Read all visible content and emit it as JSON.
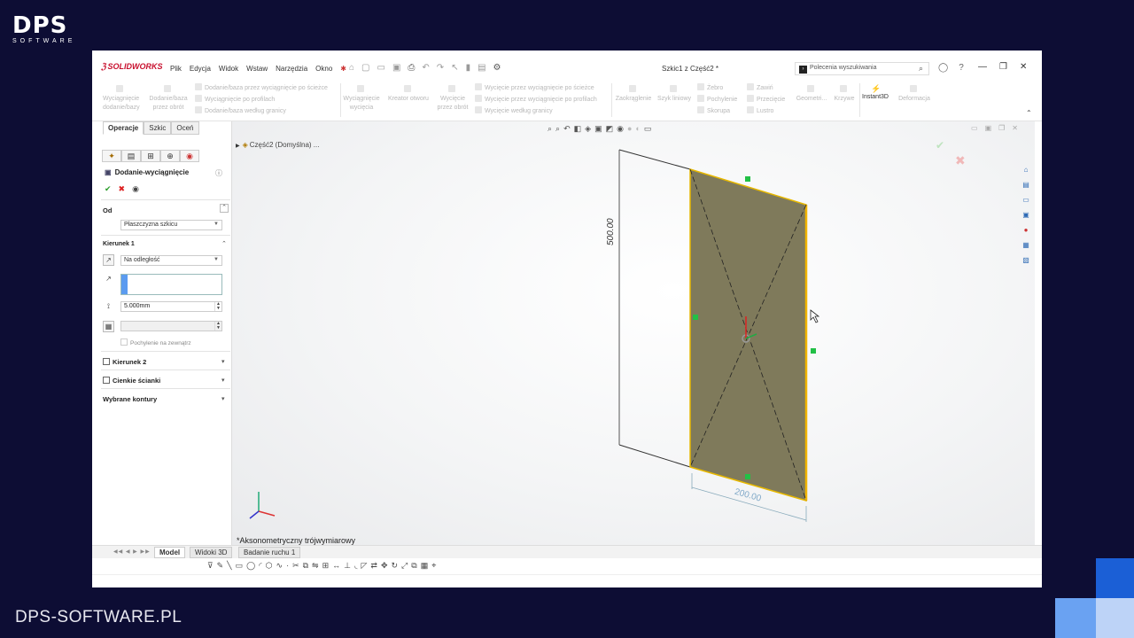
{
  "branding": {
    "logo_main": "DPS",
    "logo_sub": "SOFTWARE",
    "url": "DPS-SOFTWARE.PL"
  },
  "titlebar": {
    "app_logo": "SOLIDWORKS",
    "menus": [
      "Plik",
      "Edycja",
      "Widok",
      "Wstaw",
      "Narzędzia",
      "Okno"
    ],
    "doc_title": "Szkic1 z Część2 *",
    "search_placeholder": "Polecenia wyszukiwania",
    "win_minimize": "—",
    "win_restore": "❐",
    "win_close": "✕"
  },
  "command_manager": {
    "extrude_boss": "Wyciągnięcie dodanie/bazy",
    "revolve_boss": "Dodanie/baza przez obrót",
    "sweep_boss": "Dodanie/baza przez wyciągnięcie po ścieżce",
    "loft_boss": "Wyciągnięcie po profilach",
    "boundary_boss": "Dodanie/baza według granicy",
    "extrude_cut": "Wyciągnięcie wycięcia",
    "hole_wizard": "Kreator otworu",
    "revolve_cut": "Wycięcie przez obrót",
    "sweep_cut": "Wycięcie przez wyciągnięcie po ścieżce",
    "loft_cut": "Wycięcie przez wyciągnięcie po profilach",
    "boundary_cut": "Wycięcie według granicy",
    "fillet": "Zaokrąglenie",
    "linear_pattern": "Szyk liniowy",
    "rib": "Żebro",
    "draft": "Pochylenie",
    "shell": "Skorupa",
    "wrap": "Zawiń",
    "intersect": "Przecięcie",
    "mirror": "Lustro",
    "reference_geometry": "Geometri...",
    "curves": "Krzywe",
    "instant3d": "Instant3D",
    "deform": "Deformacja"
  },
  "panel": {
    "tabs": [
      "Operacje",
      "Szkic",
      "Oceń"
    ],
    "feature_title": "Dodanie-wyciągnięcie",
    "from_label": "Od",
    "from_value": "Płaszczyzna szkicu",
    "direction1_label": "Kierunek 1",
    "end_condition": "Na odległość",
    "depth_value": "5.000mm",
    "draft_outward": "Pochylenie na zewnątrz",
    "direction2_label": "Kierunek 2",
    "thin_feature_label": "Cienkie ścianki",
    "selected_contours_label": "Wybrane kontury"
  },
  "graphics": {
    "tree_root": "Część2 (Domyślna) ...",
    "dim_vertical": "500.00",
    "dim_horizontal": "200.00",
    "view_orientation": "*Aksonometryczny trójwymiarowy",
    "colors": {
      "face_fill": "#7f7a5b",
      "edge_highlight": "#e7b800",
      "relation_marker": "#22c046"
    }
  },
  "model_tabs": [
    "Model",
    "Widoki 3D",
    "Badanie ruchu 1"
  ]
}
